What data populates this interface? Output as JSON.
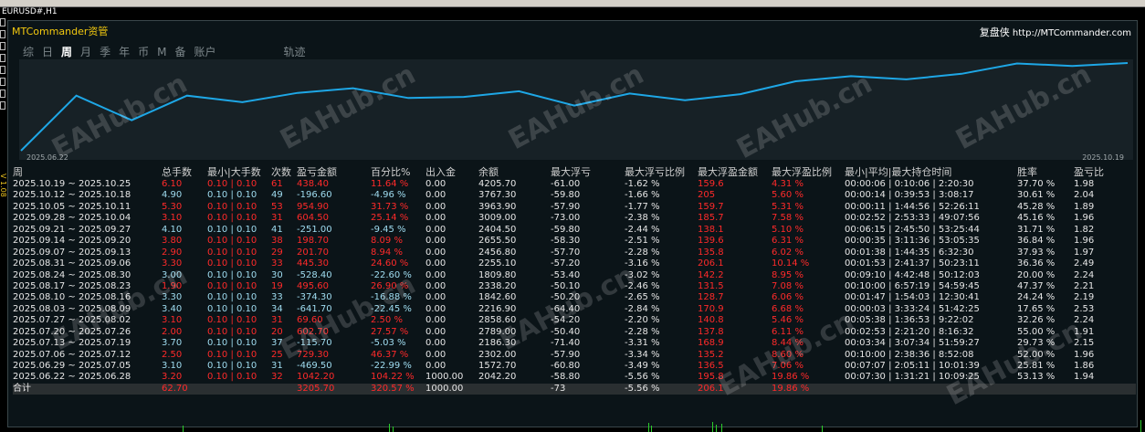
{
  "window": {
    "symbol": "EURUSD#,H1",
    "side_text": "V 1.08"
  },
  "panel": {
    "brand": "MTCommander资管",
    "site_cn": "复盘侠",
    "site_url": "http://MTCommander.com",
    "watermark": "EAHub.cn"
  },
  "tabs": [
    {
      "label": "综",
      "active": false
    },
    {
      "label": "日",
      "active": false
    },
    {
      "label": "周",
      "active": true
    },
    {
      "label": "月",
      "active": false
    },
    {
      "label": "季",
      "active": false
    },
    {
      "label": "年",
      "active": false
    },
    {
      "label": "币",
      "active": false
    },
    {
      "label": "M",
      "active": false
    },
    {
      "label": "备",
      "active": false
    },
    {
      "label": "账户",
      "active": false
    },
    {
      "label": "轨迹",
      "active": false
    }
  ],
  "chart_data": {
    "type": "line",
    "x_start_label": "2025.06.22",
    "x_end_label": "2025.10.19",
    "color": "#1ea7e6",
    "background": "#172126",
    "values": [
      2042.2,
      2302.0,
      2186.3,
      2302.0,
      2271.0,
      2315.0,
      2337.0,
      2291.0,
      2296.0,
      2323.0,
      2255.1,
      2312.0,
      2280.0,
      2309.0,
      2370.0,
      2394.0,
      2379.0,
      2405.0,
      2454.0,
      2442.0,
      2456.0
    ]
  },
  "table": {
    "headers": [
      "周",
      "总手数",
      "最小|大手数",
      "次数",
      "盈亏金额",
      "百分比%",
      "出入金",
      "余额",
      "最大浮亏",
      "最大浮亏比例",
      "最大浮盈金额",
      "最大浮盈比例",
      "最小|平均|最大持仓时间",
      "胜率",
      "盈亏比"
    ],
    "rows": [
      [
        "2025.10.19 ~ 2025.10.25",
        "6.10",
        "0.10 | 0.10",
        "61",
        "438.40",
        "11.64 %",
        "0.00",
        "4205.70",
        "-61.00",
        "-1.62 %",
        "159.6",
        "4.31 %",
        "00:00:06 | 0:10:06 | 2:20:30",
        "37.70 %",
        "1.98"
      ],
      [
        "2025.10.12 ~ 2025.10.18",
        "4.90",
        "0.10 | 0.10",
        "49",
        "-196.60",
        "-4.96 %",
        "0.00",
        "3767.30",
        "-59.80",
        "-1.66 %",
        "205",
        "5.60 %",
        "00:00:14 | 0:39:53 | 3:08:17",
        "30.61 %",
        "2.04"
      ],
      [
        "2025.10.05 ~ 2025.10.11",
        "5.30",
        "0.10 | 0.10",
        "53",
        "954.90",
        "31.73 %",
        "0.00",
        "3963.90",
        "-57.90",
        "-1.77 %",
        "159.7",
        "5.31 %",
        "00:00:11 | 1:44:56 | 52:26:11",
        "45.28 %",
        "1.89"
      ],
      [
        "2025.09.28 ~ 2025.10.04",
        "3.10",
        "0.10 | 0.10",
        "31",
        "604.50",
        "25.14 %",
        "0.00",
        "3009.00",
        "-73.00",
        "-2.38 %",
        "185.7",
        "7.58 %",
        "00:02:52 | 2:53:33 | 49:07:56",
        "45.16 %",
        "1.96"
      ],
      [
        "2025.09.21 ~ 2025.09.27",
        "4.10",
        "0.10 | 0.10",
        "41",
        "-251.00",
        "-9.45 %",
        "0.00",
        "2404.50",
        "-59.80",
        "-2.44 %",
        "138.1",
        "5.10 %",
        "00:06:15 | 2:45:50 | 53:25:44",
        "31.71 %",
        "1.82"
      ],
      [
        "2025.09.14 ~ 2025.09.20",
        "3.80",
        "0.10 | 0.10",
        "38",
        "198.70",
        "8.09 %",
        "0.00",
        "2655.50",
        "-58.30",
        "-2.51 %",
        "139.6",
        "6.31 %",
        "00:00:35 | 3:11:36 | 53:05:35",
        "36.84 %",
        "1.96"
      ],
      [
        "2025.09.07 ~ 2025.09.13",
        "2.90",
        "0.10 | 0.10",
        "29",
        "201.70",
        "8.94 %",
        "0.00",
        "2456.80",
        "-57.70",
        "-2.28 %",
        "135.8",
        "6.02 %",
        "00:01:38 | 1:44:35 | 6:32:30",
        "37.93 %",
        "1.97"
      ],
      [
        "2025.08.31 ~ 2025.09.06",
        "3.30",
        "0.10 | 0.10",
        "33",
        "445.30",
        "24.60 %",
        "0.00",
        "2255.10",
        "-57.20",
        "-3.16 %",
        "206.1",
        "10.14 %",
        "00:01:53 | 2:41:37 | 50:23:11",
        "36.36 %",
        "2.49"
      ],
      [
        "2025.08.24 ~ 2025.08.30",
        "3.00",
        "0.10 | 0.10",
        "30",
        "-528.40",
        "-22.60 %",
        "0.00",
        "1809.80",
        "-53.40",
        "-3.02 %",
        "142.2",
        "8.95 %",
        "00:09:10 | 4:42:48 | 50:12:03",
        "20.00 %",
        "2.24"
      ],
      [
        "2025.08.17 ~ 2025.08.23",
        "1.90",
        "0.10 | 0.10",
        "19",
        "495.60",
        "26.90 %",
        "0.00",
        "2338.20",
        "-50.10",
        "-2.46 %",
        "131.5",
        "7.08 %",
        "00:10:00 | 6:57:19 | 54:59:45",
        "47.37 %",
        "2.21"
      ],
      [
        "2025.08.10 ~ 2025.08.16",
        "3.30",
        "0.10 | 0.10",
        "33",
        "-374.30",
        "-16.88 %",
        "0.00",
        "1842.60",
        "-50.20",
        "-2.65 %",
        "128.7",
        "6.06 %",
        "00:01:47 | 1:54:03 | 12:30:41",
        "24.24 %",
        "2.19"
      ],
      [
        "2025.08.03 ~ 2025.08.09",
        "3.40",
        "0.10 | 0.10",
        "34",
        "-641.70",
        "-22.45 %",
        "0.00",
        "2216.90",
        "-64.40",
        "-2.84 %",
        "170.9",
        "6.68 %",
        "00:00:03 | 3:33:24 | 51:42:25",
        "17.65 %",
        "2.53"
      ],
      [
        "2025.07.27 ~ 2025.08.02",
        "3.10",
        "0.10 | 0.10",
        "31",
        "69.60",
        "2.50 %",
        "0.00",
        "2858.60",
        "-54.20",
        "-2.20 %",
        "140.8",
        "5.46 %",
        "00:05:38 | 1:36:53 | 9:22:02",
        "32.26 %",
        "2.24"
      ],
      [
        "2025.07.20 ~ 2025.07.26",
        "2.00",
        "0.10 | 0.10",
        "20",
        "602.70",
        "27.57 %",
        "0.00",
        "2789.00",
        "-50.40",
        "-2.28 %",
        "137.8",
        "6.11 %",
        "00:02:53 | 2:21:20 | 8:16:32",
        "55.00 %",
        "1.91"
      ],
      [
        "2025.07.13 ~ 2025.07.19",
        "3.70",
        "0.10 | 0.10",
        "37",
        "-115.70",
        "-5.03 %",
        "0.00",
        "2186.30",
        "-71.40",
        "-3.31 %",
        "168.9",
        "8.44 %",
        "00:03:34 | 3:07:34 | 51:59:27",
        "29.73 %",
        "2.15"
      ],
      [
        "2025.07.06 ~ 2025.07.12",
        "2.50",
        "0.10 | 0.10",
        "25",
        "729.30",
        "46.37 %",
        "0.00",
        "2302.00",
        "-57.90",
        "-3.34 %",
        "135.2",
        "8.60 %",
        "00:10:00 | 2:38:36 | 8:52:08",
        "52.00 %",
        "1.96"
      ],
      [
        "2025.06.29 ~ 2025.07.05",
        "3.10",
        "0.10 | 0.10",
        "31",
        "-469.50",
        "-22.99 %",
        "0.00",
        "1572.70",
        "-60.80",
        "-3.49 %",
        "136.5",
        "7.06 %",
        "00:07:07 | 2:05:11 | 10:01:39",
        "25.81 %",
        "1.86"
      ],
      [
        "2025.06.22 ~ 2025.06.28",
        "3.20",
        "0.10 | 0.10",
        "32",
        "1042.20",
        "104.22 %",
        "1000.00",
        "2042.20",
        "-58.80",
        "-5.56 %",
        "195.8",
        "19.86 %",
        "00:07:30 | 1:31:21 | 10:09:25",
        "53.13 %",
        "1.94"
      ]
    ],
    "total": [
      "合计",
      "62.70",
      "",
      "",
      "3205.70",
      "320.57 %",
      "1000.00",
      "",
      "-73",
      "-5.56 %",
      "206.1",
      "19.86 %",
      "",
      "",
      ""
    ]
  }
}
